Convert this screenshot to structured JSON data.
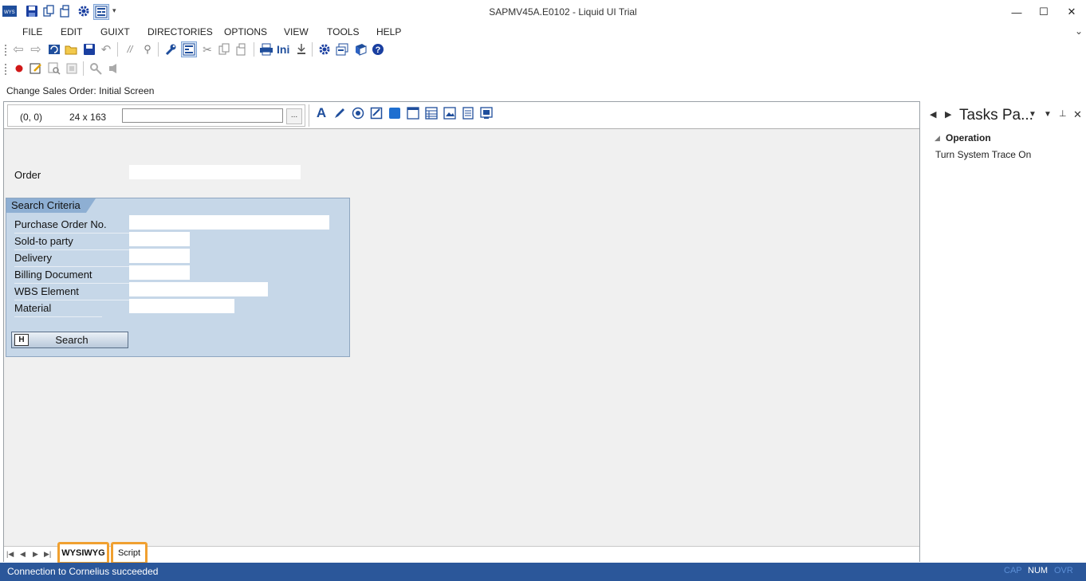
{
  "window": {
    "title": "SAPMV45A.E0102 - Liquid UI Trial",
    "minimize_label": "—",
    "maximize_label": "☐",
    "close_label": "✕"
  },
  "menu": [
    "FILE",
    "EDIT",
    "GUIXT",
    "DIRECTORIES",
    "OPTIONS",
    "VIEW",
    "TOOLS",
    "HELP"
  ],
  "toolbar": {
    "ini_label": "Ini"
  },
  "screen_title": "Change Sales Order: Initial Screen",
  "designer": {
    "position": "(0, 0)",
    "size": "24 x 163",
    "property_value": "",
    "browse_label": "..."
  },
  "form": {
    "order_label": "Order",
    "group_title": "Search Criteria",
    "fields": [
      {
        "label": "Purchase Order No."
      },
      {
        "label": "Sold-to party"
      },
      {
        "label": "Delivery"
      },
      {
        "label": "Billing Document"
      },
      {
        "label": "WBS Element"
      },
      {
        "label": "Material"
      }
    ],
    "search_button": "Search"
  },
  "tabs": [
    "WYSIWYG",
    "Script"
  ],
  "tasks_pane": {
    "title": "Tasks Pa...",
    "section": "Operation",
    "item": "Turn System Trace On"
  },
  "status": {
    "message": "Connection to Cornelius succeeded",
    "cap": "CAP",
    "num": "NUM",
    "ovr": "OVR"
  },
  "colors": {
    "accent_blue": "#1f4e9c",
    "status_bar": "#2b579a",
    "group_bg": "#c6d7e8",
    "tab_highlight": "#f0a030"
  }
}
